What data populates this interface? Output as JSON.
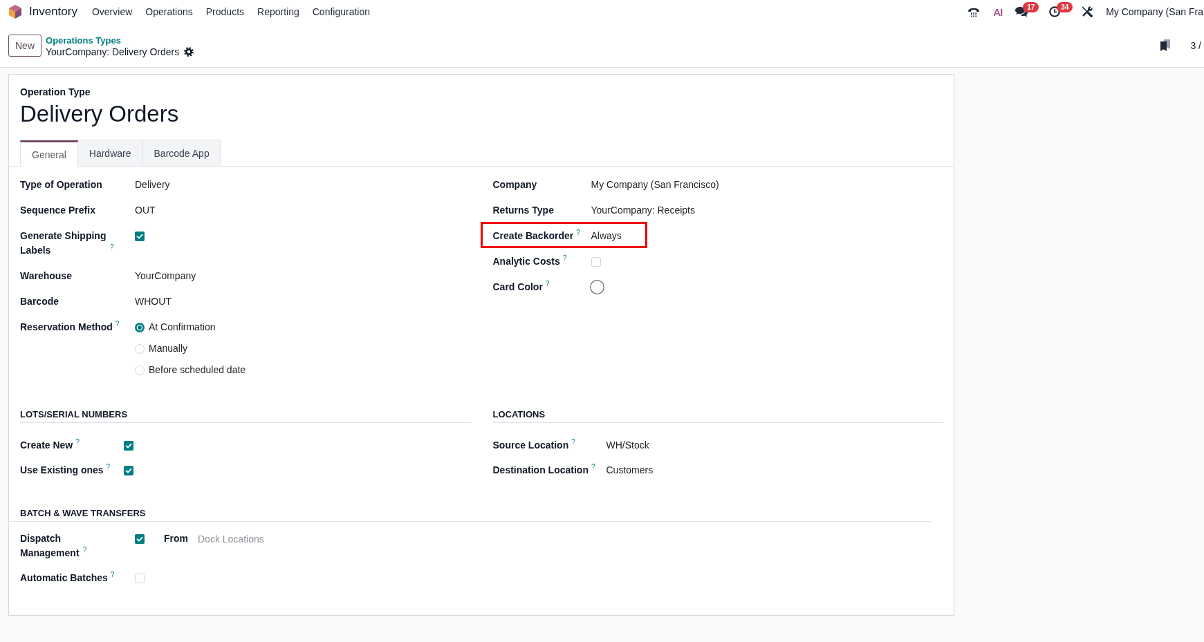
{
  "navbar": {
    "app_name": "Inventory",
    "menu": [
      "Overview",
      "Operations",
      "Products",
      "Reporting",
      "Configuration"
    ],
    "systray": [
      {
        "kind": "phone"
      },
      {
        "kind": "ai",
        "label": "AI"
      },
      {
        "kind": "messages",
        "badge": "17"
      },
      {
        "kind": "activities",
        "badge": "34"
      },
      {
        "kind": "tools"
      }
    ],
    "company": "My Company (San Fra"
  },
  "control_panel": {
    "new_button": "New",
    "breadcrumb": "Operations Types",
    "record_name": "YourCompany: Delivery Orders",
    "pager": "3 /"
  },
  "form": {
    "subtitle": "Operation Type",
    "title": "Delivery Orders",
    "tabs": [
      {
        "label": "General",
        "selected": true
      },
      {
        "label": "Hardware",
        "selected": false
      },
      {
        "label": "Barcode App",
        "selected": false
      }
    ],
    "left_fields": [
      {
        "kind": "text",
        "label": "Type of Operation",
        "value": "Delivery"
      },
      {
        "kind": "text",
        "label": "Sequence Prefix",
        "value": "OUT"
      },
      {
        "kind": "checkbox",
        "label": "Generate Shipping Labels",
        "hint": "?",
        "checked": true
      },
      {
        "kind": "text",
        "label": "Warehouse",
        "value": "YourCompany"
      },
      {
        "kind": "text",
        "label": "Barcode",
        "value": "WHOUT"
      },
      {
        "kind": "radio",
        "label": "Reservation Method",
        "hint": "?",
        "options": [
          {
            "label": "At Confirmation",
            "selected": true
          },
          {
            "label": "Manually",
            "selected": false
          },
          {
            "label": "Before scheduled date",
            "selected": false
          }
        ]
      }
    ],
    "right_fields": [
      {
        "kind": "text",
        "label": "Company",
        "value": "My Company (San Francisco)",
        "highlighted": false
      },
      {
        "kind": "text",
        "label": "Returns Type",
        "value": "YourCompany: Receipts",
        "highlighted": false
      },
      {
        "kind": "text",
        "label": "Create Backorder",
        "hint": "?",
        "value": "Always",
        "highlighted": true
      },
      {
        "kind": "checkbox",
        "label": "Analytic Costs",
        "hint": "?",
        "checked": false,
        "highlighted": false
      },
      {
        "kind": "color",
        "label": "Card Color",
        "hint": "?",
        "highlighted": false
      }
    ],
    "lots_section": {
      "heading": "LOTS/SERIAL NUMBERS",
      "fields": [
        {
          "kind": "checkbox",
          "label": "Create New",
          "hint": "?",
          "checked": true
        },
        {
          "kind": "checkbox",
          "label": "Use Existing ones",
          "hint": "?",
          "checked": true
        }
      ]
    },
    "locations_section": {
      "heading": "LOCATIONS",
      "fields": [
        {
          "kind": "text",
          "label": "Source Location",
          "hint": "?",
          "value": "WH/Stock"
        },
        {
          "kind": "text",
          "label": "Destination Location",
          "hint": "?",
          "value": "Customers"
        }
      ]
    },
    "batch_section": {
      "heading": "BATCH & WAVE TRANSFERS",
      "fields": [
        {
          "kind": "checkbox_from",
          "label": "Dispatch Management",
          "hint": "?",
          "checked": true,
          "extra_label": "From",
          "placeholder": "Dock Locations"
        },
        {
          "kind": "checkbox",
          "label": "Automatic Batches",
          "hint": "?",
          "checked": false
        }
      ]
    }
  }
}
